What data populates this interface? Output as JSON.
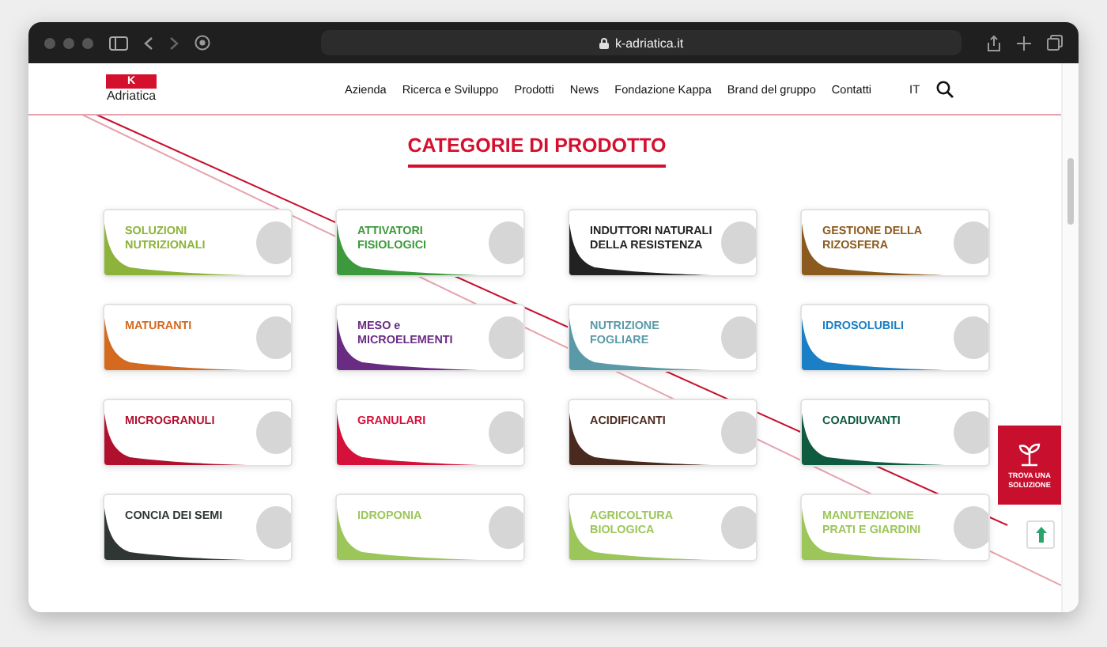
{
  "browser": {
    "url": "k-adriatica.it"
  },
  "header": {
    "logo_mark": "K",
    "logo_text": "Adriatica",
    "nav": [
      "Azienda",
      "Ricerca e Sviluppo",
      "Prodotti",
      "News",
      "Fondazione Kappa",
      "Brand del gruppo",
      "Contatti"
    ],
    "language": "IT"
  },
  "title": "CATEGORIE DI PRODOTTO",
  "categories": [
    {
      "label": "SOLUZIONI NUTRIZIONALI",
      "color": "#8db33a"
    },
    {
      "label": "ATTIVATORI FISIOLOGICI",
      "color": "#3d9a3c"
    },
    {
      "label": "INDUTTORI NATURALI DELLA RESISTENZA",
      "color": "#222222"
    },
    {
      "label": "GESTIONE DELLA RIZOSFERA",
      "color": "#8b5a1e"
    },
    {
      "label": "MATURANTI",
      "color": "#d46a1f"
    },
    {
      "label": "MESO e MICROELEMENTI",
      "color": "#6a2c83"
    },
    {
      "label": "NUTRIZIONE FOGLIARE",
      "color": "#5a9aa8"
    },
    {
      "label": "IDROSOLUBILI",
      "color": "#1a7fc4"
    },
    {
      "label": "MICROGRANULI",
      "color": "#b0102e"
    },
    {
      "label": "GRANULARI",
      "color": "#d5103a"
    },
    {
      "label": "ACIDIFICANTI",
      "color": "#4a2a1e"
    },
    {
      "label": "COADIUVANTI",
      "color": "#0f5b3f"
    },
    {
      "label": "CONCIA DEI SEMI",
      "color": "#2f3633"
    },
    {
      "label": "IDROPONIA",
      "color": "#9cc65a"
    },
    {
      "label": "AGRICOLTURA BIOLOGICA",
      "color": "#9cc65a"
    },
    {
      "label": "MANUTENZIONE PRATI E GIARDINI",
      "color": "#9cc65a"
    }
  ],
  "solution_button": {
    "label": "TROVA UNA SOLUZIONE"
  }
}
